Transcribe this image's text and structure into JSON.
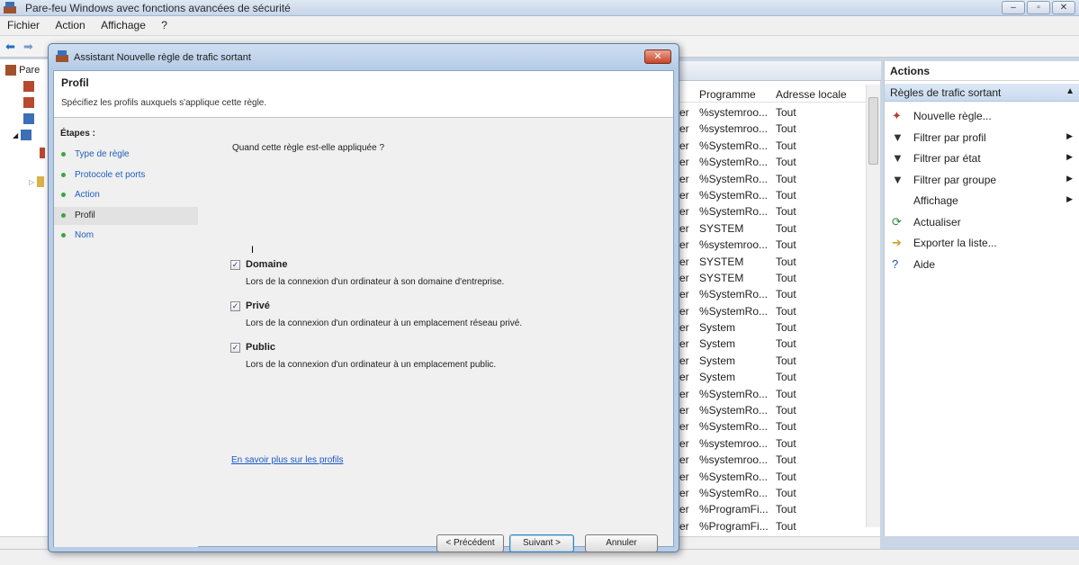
{
  "window": {
    "title": "Pare-feu Windows avec fonctions avancées de sécurité",
    "controls": [
      "–",
      "▫",
      "✕"
    ]
  },
  "menu": [
    "Fichier",
    "Action",
    "Affichage",
    "?"
  ],
  "tree": {
    "root_label": "Pare"
  },
  "list": {
    "columns": [
      "Programme",
      "Adresse locale"
    ],
    "rows": [
      [
        "er",
        "%systemroo...",
        "Tout"
      ],
      [
        "er",
        "%systemroo...",
        "Tout"
      ],
      [
        "er",
        "%SystemRo...",
        "Tout"
      ],
      [
        "er",
        "%SystemRo...",
        "Tout"
      ],
      [
        "er",
        "%SystemRo...",
        "Tout"
      ],
      [
        "er",
        "%SystemRo...",
        "Tout"
      ],
      [
        "er",
        "%SystemRo...",
        "Tout"
      ],
      [
        "er",
        "SYSTEM",
        "Tout"
      ],
      [
        "er",
        "%systemroo...",
        "Tout"
      ],
      [
        "er",
        "SYSTEM",
        "Tout"
      ],
      [
        "er",
        "SYSTEM",
        "Tout"
      ],
      [
        "er",
        "%SystemRo...",
        "Tout"
      ],
      [
        "er",
        "%SystemRo...",
        "Tout"
      ],
      [
        "er",
        "System",
        "Tout"
      ],
      [
        "er",
        "System",
        "Tout"
      ],
      [
        "er",
        "System",
        "Tout"
      ],
      [
        "er",
        "System",
        "Tout"
      ],
      [
        "er",
        "%SystemRo...",
        "Tout"
      ],
      [
        "er",
        "%SystemRo...",
        "Tout"
      ],
      [
        "er",
        "%SystemRo...",
        "Tout"
      ],
      [
        "er",
        "%systemroo...",
        "Tout"
      ],
      [
        "er",
        "%systemroo...",
        "Tout"
      ],
      [
        "er",
        "%SystemRo...",
        "Tout"
      ],
      [
        "er",
        "%SystemRo...",
        "Tout"
      ],
      [
        "er",
        "%ProgramFi...",
        "Tout"
      ],
      [
        "er",
        "%ProgramFi...",
        "Tout"
      ]
    ]
  },
  "actions": {
    "header": "Actions",
    "section": "Règles de trafic sortant",
    "items": [
      {
        "label": "Nouvelle règle...",
        "icon": "new-rule-icon",
        "glyph": "✦",
        "color": "#c0392b",
        "submenu": false
      },
      {
        "label": "Filtrer par profil",
        "icon": "filter-icon",
        "glyph": "▼",
        "color": "#333333",
        "submenu": true
      },
      {
        "label": "Filtrer par état",
        "icon": "filter-icon",
        "glyph": "▼",
        "color": "#333333",
        "submenu": true
      },
      {
        "label": "Filtrer par groupe",
        "icon": "filter-icon",
        "glyph": "▼",
        "color": "#333333",
        "submenu": true
      },
      {
        "label": "Affichage",
        "icon": "",
        "glyph": "",
        "color": "#333333",
        "submenu": true
      },
      {
        "label": "Actualiser",
        "icon": "refresh-icon",
        "glyph": "⟳",
        "color": "#2e8b3a",
        "submenu": false
      },
      {
        "label": "Exporter la liste...",
        "icon": "export-icon",
        "glyph": "➔",
        "color": "#c9a227",
        "submenu": false
      },
      {
        "label": "Aide",
        "icon": "help-icon",
        "glyph": "?",
        "color": "#1f4fbf",
        "submenu": false
      }
    ]
  },
  "dialog": {
    "title": "Assistant Nouvelle règle de trafic sortant",
    "close": "✕",
    "heading": "Profil",
    "subheading": "Spécifiez les profils auxquels s'applique cette règle.",
    "steps_header": "Étapes :",
    "steps": [
      "Type de règle",
      "Protocole et ports",
      "Action",
      "Profil",
      "Nom"
    ],
    "active_step": 3,
    "question": "Quand cette règle est-elle appliquée ?",
    "options": [
      {
        "label": "Domaine",
        "desc": "Lors de la connexion d'un ordinateur à son domaine d'entreprise.",
        "checked": true
      },
      {
        "label": "Privé",
        "desc": "Lors de la connexion d'un ordinateur à un emplacement réseau privé.",
        "checked": true
      },
      {
        "label": "Public",
        "desc": "Lors de la connexion d'un ordinateur à un emplacement public.",
        "checked": true
      }
    ],
    "learn_more": "En savoir plus sur les profils",
    "buttons": {
      "back": "< Précédent",
      "next": "Suivant >",
      "cancel": "Annuler"
    }
  },
  "colors": {
    "accent": "#1f5fbf",
    "step_dot": "#3ba63b",
    "close_btn": "#c7452a"
  }
}
